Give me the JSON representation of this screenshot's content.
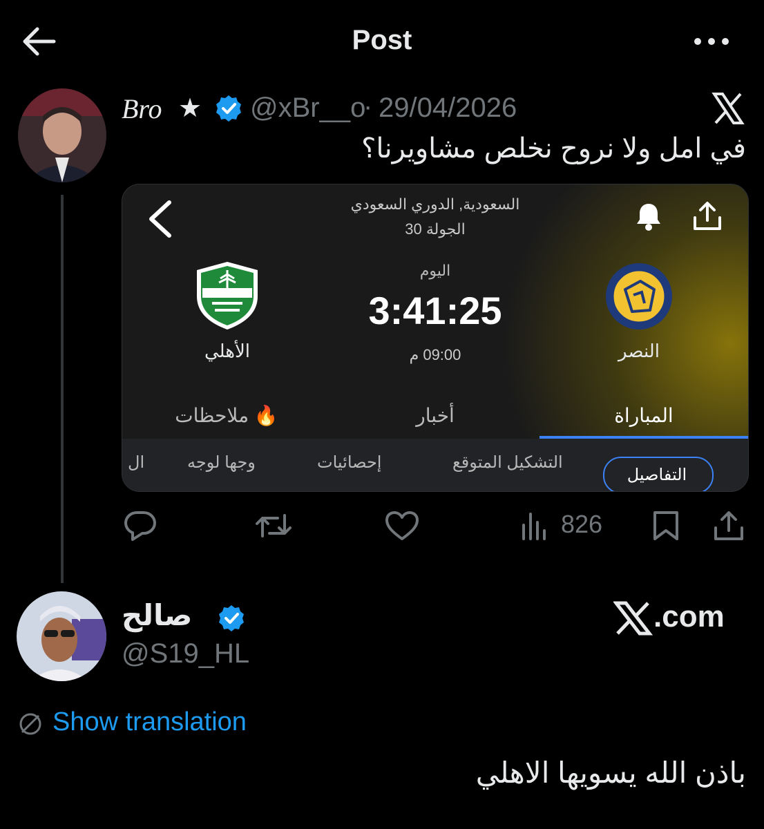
{
  "header": {
    "title": "Post"
  },
  "tweet1": {
    "name": "Bro",
    "star": "★",
    "handle": "@xBr__o",
    "separator": "·",
    "date": "29/04/2026",
    "text": "في امل ولا نروح نخلص مشاويرنا؟",
    "views": "826"
  },
  "card": {
    "league": "السعودية, الدوري السعودي",
    "round": "الجولة 30",
    "day": "اليوم",
    "countdown": "3:41:25",
    "kickoff": "09:00 م",
    "home_team": "النصر",
    "away_team": "الأهلي",
    "tabs": [
      "المباراة",
      "أخبار",
      "🔥 ملاحظات"
    ],
    "subtabs": [
      "التفاصيل",
      "التشكيل المتوقع",
      "إحصائيات",
      "وجها لوجه",
      "ال"
    ],
    "accent": "#3b82f6"
  },
  "tweet2": {
    "name": "صالح",
    "handle": "@S19_HL",
    "site": ".com",
    "translate_label": "Show translation",
    "text": "باذن الله يسويها الاهلي"
  },
  "colors": {
    "background": "#000000",
    "text": "#e7e9ea",
    "muted": "#71767b",
    "link": "#1d9bf0",
    "verified": "#1d9bf0"
  }
}
